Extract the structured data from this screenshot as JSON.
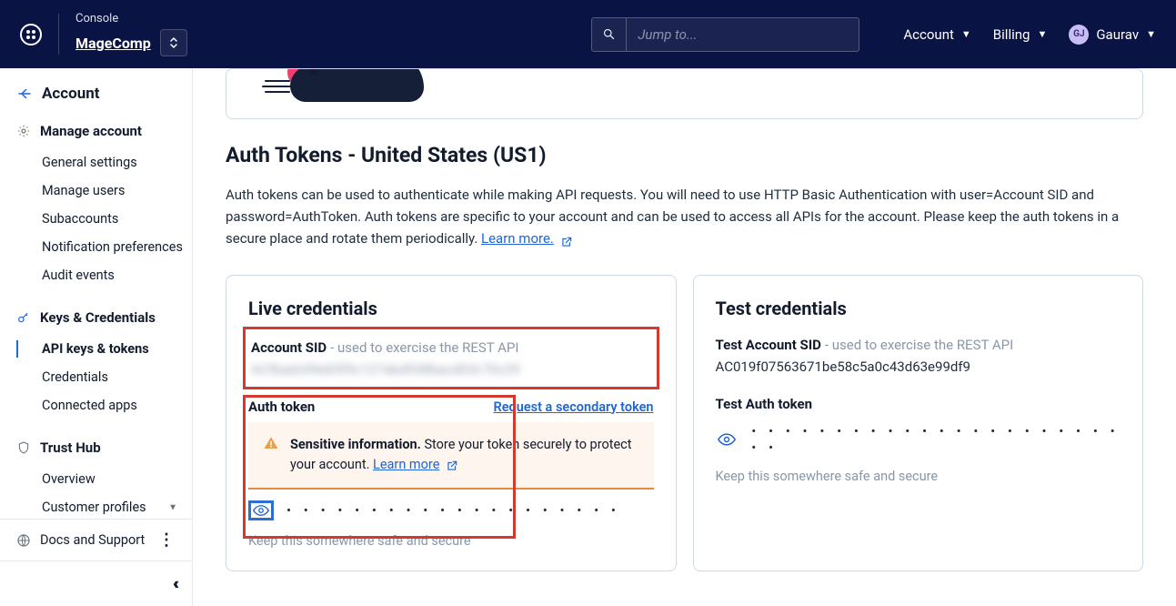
{
  "topbar": {
    "console_label": "Console",
    "org_name": "MageComp",
    "search_placeholder": "Jump to...",
    "nav": {
      "account": "Account",
      "billing": "Billing"
    },
    "user_initials": "GJ",
    "user_name": "Gaurav"
  },
  "sidebar": {
    "back_label": "Account",
    "sections": {
      "manage": {
        "head": "Manage account",
        "items": [
          "General settings",
          "Manage users",
          "Subaccounts",
          "Notification preferences",
          "Audit events"
        ]
      },
      "keys": {
        "head": "Keys & Credentials",
        "items": [
          "API keys & tokens",
          "Credentials",
          "Connected apps"
        ],
        "active_index": 0
      },
      "trust": {
        "head": "Trust Hub",
        "items": [
          "Overview",
          "Customer profiles"
        ]
      }
    },
    "docs": "Docs and Support"
  },
  "main": {
    "auth_tokens": {
      "title": "Auth Tokens - United States (US1)",
      "desc": "Auth tokens can be used to authenticate while making API requests. You will need to use HTTP Basic Authentication with user=Account SID and password=AuthToken. Auth tokens are specific to your account and can be used to access all APIs for the account. Please keep the auth tokens in a secure place and rotate them periodically. ",
      "learn_more": "Learn more."
    },
    "live": {
      "title": "Live credentials",
      "sid_label": "Account SID",
      "sid_hint": " - used to exercise the REST API",
      "sid_value": "ACfbadc09e83f9c127abd938bacd03c70c29",
      "auth_label": "Auth token",
      "request_secondary": "Request a secondary token",
      "warn_bold": "Sensitive information.",
      "warn_text": " Store your token securely to protect your account. ",
      "warn_link": "Learn more",
      "token_dots": "• • • • • • • • • • • • • • • • • • • •",
      "keep_safe": "Keep this somewhere safe and secure"
    },
    "test": {
      "title": "Test credentials",
      "sid_label": "Test Account SID",
      "sid_hint": " - used to exercise the REST API",
      "sid_value": "AC019f07563671be58c5a0c43d63e99df9",
      "auth_label": "Test Auth token",
      "token_dots": "• • • • • • • • • • • • • • • • • • • • • • • •",
      "keep_safe": "Keep this somewhere safe and secure"
    }
  }
}
